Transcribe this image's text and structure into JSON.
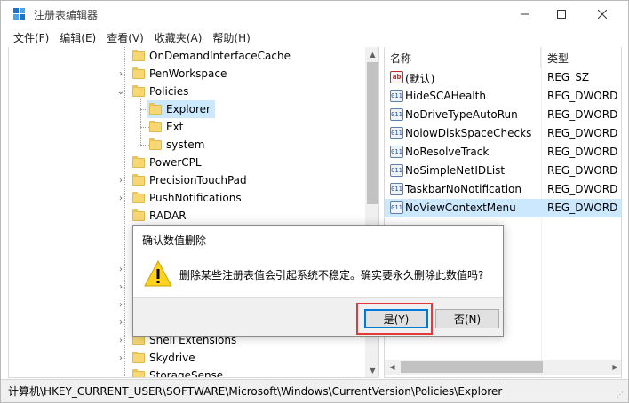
{
  "window": {
    "title": "注册表编辑器",
    "controls": {
      "minimize": "—",
      "maximize": "☐",
      "close": "✕"
    }
  },
  "menu": [
    "文件(F)",
    "编辑(E)",
    "查看(V)",
    "收藏夹(A)",
    "帮助(H)"
  ],
  "tree": {
    "items": [
      {
        "label": "OnDemandInterfaceCache",
        "expander": ""
      },
      {
        "label": "PenWorkspace",
        "expander": "›"
      },
      {
        "label": "Policies",
        "expander": "⌄"
      },
      {
        "label": "Explorer",
        "expander": "",
        "selected": true
      },
      {
        "label": "Ext",
        "expander": ""
      },
      {
        "label": "system",
        "expander": ""
      },
      {
        "label": "PowerCPL",
        "expander": ""
      },
      {
        "label": "PrecisionTouchPad",
        "expander": "›"
      },
      {
        "label": "PushNotifications",
        "expander": "›"
      },
      {
        "label": "RADAR",
        "expander": ""
      },
      {
        "label": "Shell Extensions",
        "expander": "›"
      },
      {
        "label": "Skydrive",
        "expander": "›"
      },
      {
        "label": "StorageSense",
        "expander": ""
      }
    ]
  },
  "list": {
    "columns": {
      "name": "名称",
      "type": "类型"
    },
    "rows": [
      {
        "name": "(默认)",
        "type": "REG_SZ",
        "icon": "ab"
      },
      {
        "name": "HideSCAHealth",
        "type": "REG_DWORD",
        "icon": "011"
      },
      {
        "name": "NoDriveTypeAutoRun",
        "type": "REG_DWORD",
        "icon": "011"
      },
      {
        "name": "NolowDiskSpaceChecks",
        "type": "REG_DWORD",
        "icon": "011"
      },
      {
        "name": "NoResolveTrack",
        "type": "REG_DWORD",
        "icon": "011"
      },
      {
        "name": "NoSimpleNetIDList",
        "type": "REG_DWORD",
        "icon": "011"
      },
      {
        "name": "TaskbarNoNotification",
        "type": "REG_DWORD",
        "icon": "011"
      },
      {
        "name": "NoViewContextMenu",
        "type": "REG_DWORD",
        "icon": "011",
        "selected": true
      }
    ]
  },
  "status": {
    "path": "计算机\\HKEY_CURRENT_USER\\SOFTWARE\\Microsoft\\Windows\\CurrentVersion\\Policies\\Explorer"
  },
  "dialog": {
    "title": "确认数值删除",
    "message": "删除某些注册表值会引起系统不稳定。确实要永久删除此数值吗?",
    "yes_label": "是(Y)",
    "no_label": "否(N)",
    "highlight_color": "#e23a3a"
  },
  "colors": {
    "selection": "#cce8ff",
    "folder": "#f7d774",
    "accent": "#0078d7"
  }
}
